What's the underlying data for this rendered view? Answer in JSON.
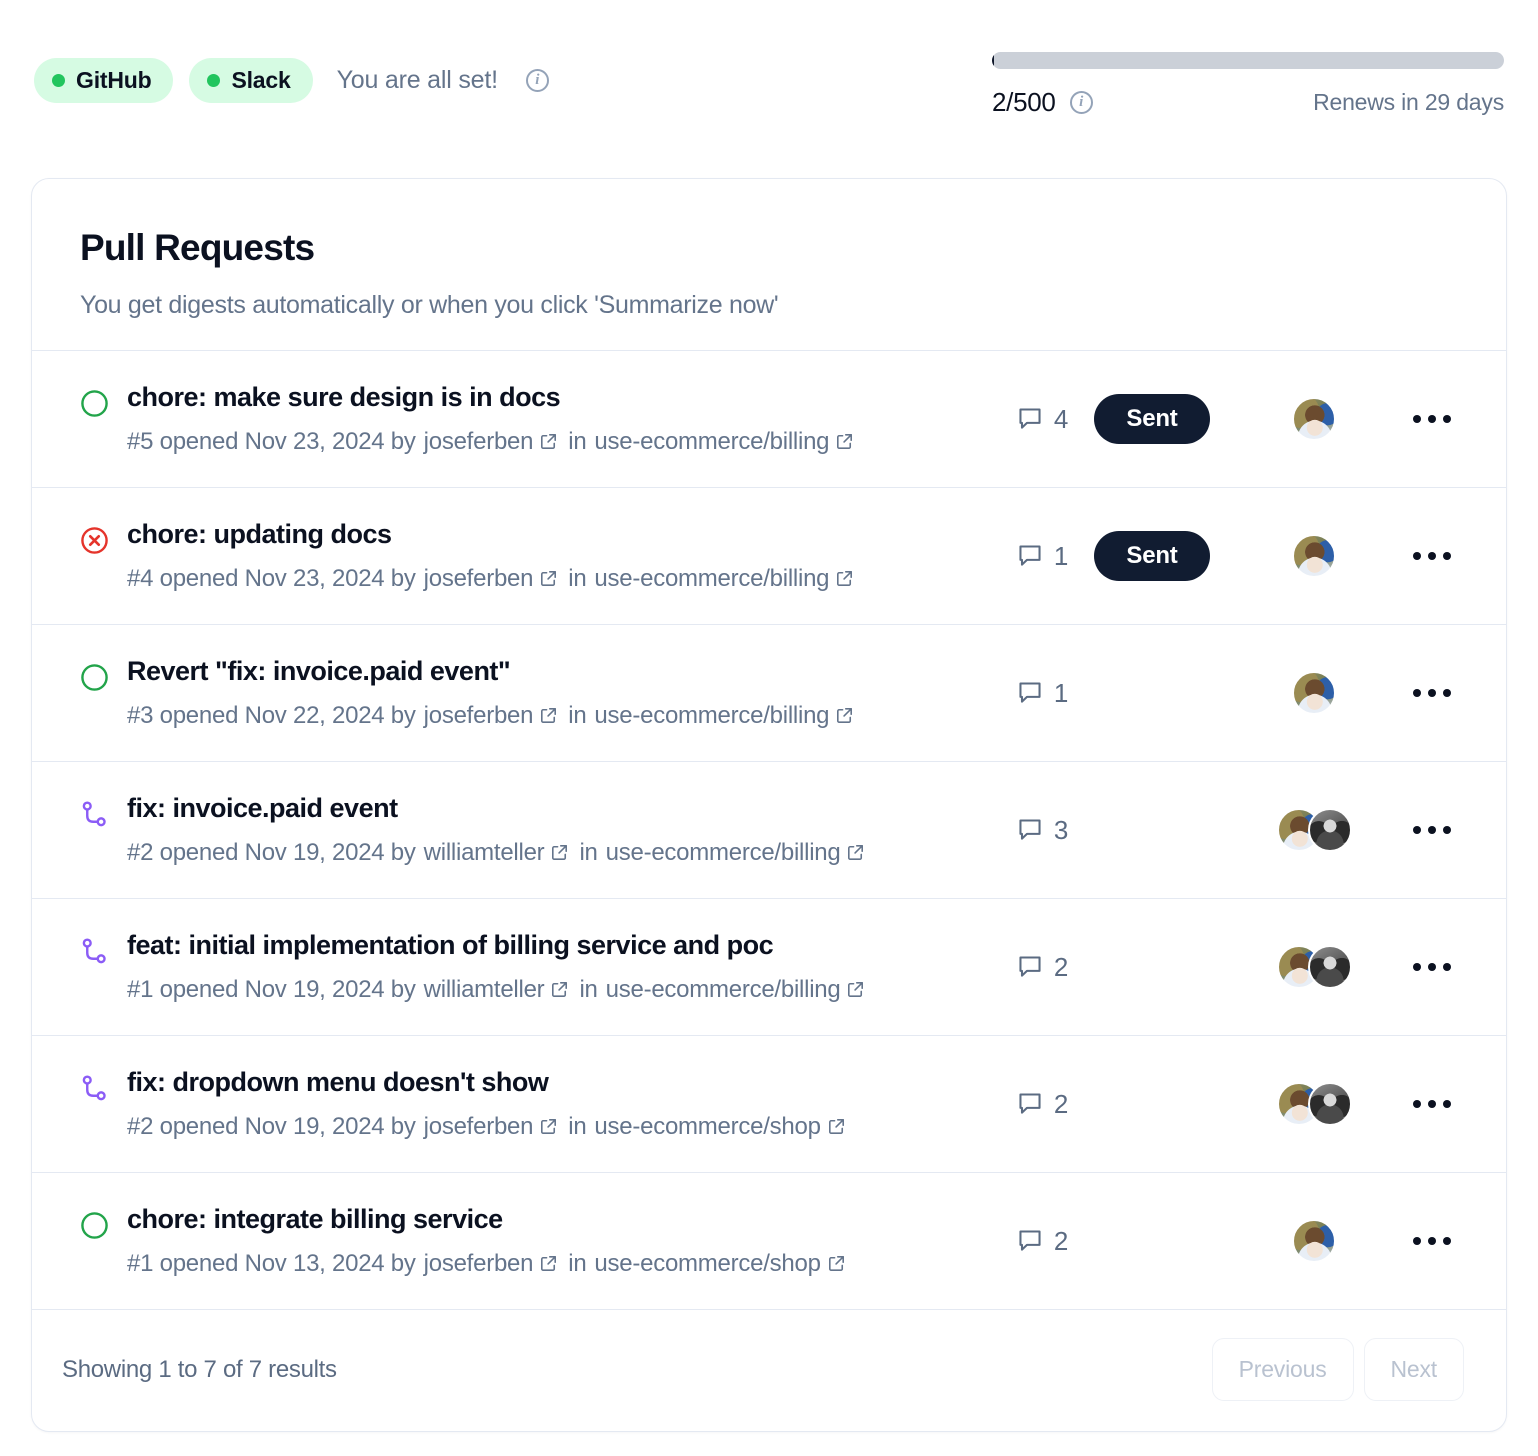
{
  "topbar": {
    "chips": [
      {
        "label": "GitHub",
        "status_color": "#22c55e"
      },
      {
        "label": "Slack",
        "status_color": "#22c55e"
      }
    ],
    "status_text": "You are all set!",
    "info_glyph": "i"
  },
  "quota": {
    "used": 2,
    "limit": 500,
    "count_label": "2/500",
    "percent": 0.4,
    "renews_label": "Renews in 29 days",
    "info_glyph": "i"
  },
  "card": {
    "title": "Pull Requests",
    "subtitle": "You get digests automatically or when you click 'Summarize now'"
  },
  "rows": [
    {
      "state": "open",
      "title": "chore: make sure design is in docs",
      "number": "#5",
      "meta_prefix": "#5 opened Nov 23, 2024 by",
      "author": "joseferben",
      "in_label": "in",
      "repo": "use-ecommerce/billing",
      "comments": "4",
      "badge": "Sent",
      "avatars": [
        "color"
      ]
    },
    {
      "state": "closed",
      "title": "chore: updating docs",
      "number": "#4",
      "meta_prefix": "#4 opened Nov 23, 2024 by",
      "author": "joseferben",
      "in_label": "in",
      "repo": "use-ecommerce/billing",
      "comments": "1",
      "badge": "Sent",
      "avatars": [
        "color"
      ]
    },
    {
      "state": "open",
      "title": "Revert \"fix: invoice.paid event\"",
      "number": "#3",
      "meta_prefix": "#3 opened Nov 22, 2024 by",
      "author": "joseferben",
      "in_label": "in",
      "repo": "use-ecommerce/billing",
      "comments": "1",
      "badge": "",
      "avatars": [
        "color"
      ]
    },
    {
      "state": "merged",
      "title": "fix: invoice.paid event",
      "number": "#2",
      "meta_prefix": "#2 opened Nov 19, 2024 by",
      "author": "williamteller",
      "in_label": "in",
      "repo": "use-ecommerce/billing",
      "comments": "3",
      "badge": "",
      "avatars": [
        "color",
        "gray"
      ]
    },
    {
      "state": "merged",
      "title": "feat: initial implementation of billing service and poc",
      "number": "#1",
      "meta_prefix": "#1 opened Nov 19, 2024 by",
      "author": "williamteller",
      "in_label": "in",
      "repo": "use-ecommerce/billing",
      "comments": "2",
      "badge": "",
      "avatars": [
        "color",
        "gray"
      ]
    },
    {
      "state": "merged",
      "title": "fix: dropdown menu doesn't show",
      "number": "#2",
      "meta_prefix": "#2 opened Nov 19, 2024 by",
      "author": "joseferben",
      "in_label": "in",
      "repo": "use-ecommerce/shop",
      "comments": "2",
      "badge": "",
      "avatars": [
        "color",
        "gray"
      ]
    },
    {
      "state": "open",
      "title": "chore: integrate billing service",
      "number": "#1",
      "meta_prefix": "#1 opened Nov 13, 2024 by",
      "author": "joseferben",
      "in_label": "in",
      "repo": "use-ecommerce/shop",
      "comments": "2",
      "badge": "",
      "avatars": [
        "color"
      ]
    }
  ],
  "footer": {
    "results_text": "Showing 1 to 7 of 7 results",
    "previous_label": "Previous",
    "next_label": "Next"
  },
  "colors": {
    "open": "#22a44a",
    "closed": "#e5342b",
    "merged": "#8b5cf6",
    "badge_bg": "#111c31",
    "muted": "#64748b"
  }
}
